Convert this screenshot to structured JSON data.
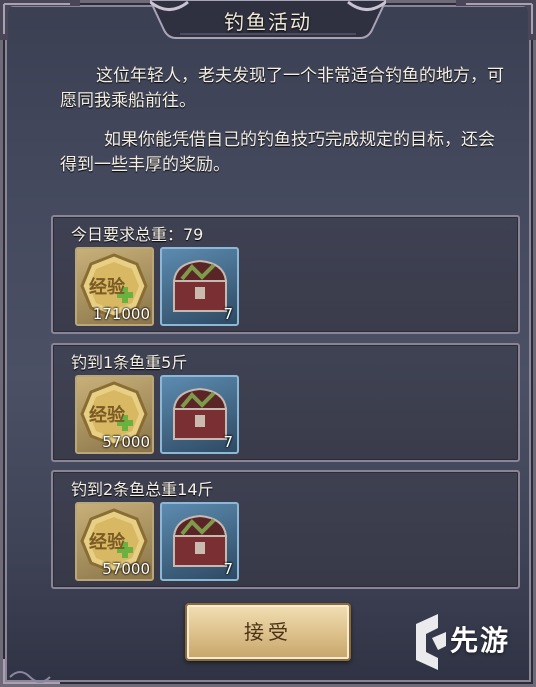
{
  "dialog": {
    "title": "钓鱼活动",
    "intro_paragraph_1": "这位年轻人，老夫发现了一个非常适合钓鱼的地方，可愿同我乘船前往。",
    "intro_paragraph_2": "如果你能凭借自己的钓鱼技巧完成规定的目标，还会得到一些丰厚的奖励。"
  },
  "rewards": [
    {
      "caption": "今日要求总重：79",
      "exp_amount": "171000",
      "chest_count": "7"
    },
    {
      "caption": "钓到1条鱼重5斤",
      "exp_amount": "57000",
      "chest_count": "7"
    },
    {
      "caption": "钓到2条鱼总重14斤",
      "exp_amount": "57000",
      "chest_count": "7"
    }
  ],
  "icons": {
    "exp_badge_text": "经验",
    "exp_badge": "experience-medal-icon",
    "chest": "treasure-chest-icon"
  },
  "accept_label": "接受",
  "watermark": "先游",
  "colors": {
    "panel_border": "#8a8596",
    "button": "#dcc08a",
    "text": "#f4efe4"
  }
}
